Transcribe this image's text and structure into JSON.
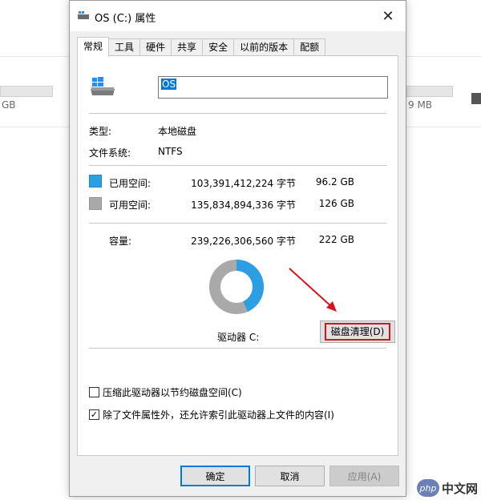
{
  "background": {
    "left_size_text": "GB",
    "right_size_text": "9 MB"
  },
  "dialog": {
    "title": "OS (C:) 属性",
    "close_icon": "close-icon",
    "tabs": [
      {
        "label": "常规",
        "active": true
      },
      {
        "label": "工具"
      },
      {
        "label": "硬件"
      },
      {
        "label": "共享"
      },
      {
        "label": "安全"
      },
      {
        "label": "以前的版本"
      },
      {
        "label": "配额"
      }
    ],
    "drive_name_value": "OS",
    "type_label": "类型:",
    "type_value": "本地磁盘",
    "fs_label": "文件系统:",
    "fs_value": "NTFS",
    "used": {
      "label": "已用空间:",
      "bytes": "103,391,412,224 字节",
      "size": "96.2 GB",
      "color": "#2c9ee3"
    },
    "free": {
      "label": "可用空间:",
      "bytes": "135,834,894,336 字节",
      "size": "126 GB",
      "color": "#a9a9a9"
    },
    "capacity": {
      "label": "容量:",
      "bytes": "239,226,306,560 字节",
      "size": "222 GB"
    },
    "drive_label": "驱动器 C:",
    "cleanup_button": "磁盘清理(D)",
    "compress_checkbox": {
      "label": "压缩此驱动器以节约磁盘空间(C)",
      "checked": false
    },
    "index_checkbox": {
      "label": "除了文件属性外，还允许索引此驱动器上文件的内容(I)",
      "checked": true
    },
    "buttons": {
      "ok": "确定",
      "cancel": "取消",
      "apply": "应用(A)"
    }
  },
  "annotation_color": "#d4151d",
  "watermark": {
    "badge": "php",
    "text": "中文网"
  }
}
